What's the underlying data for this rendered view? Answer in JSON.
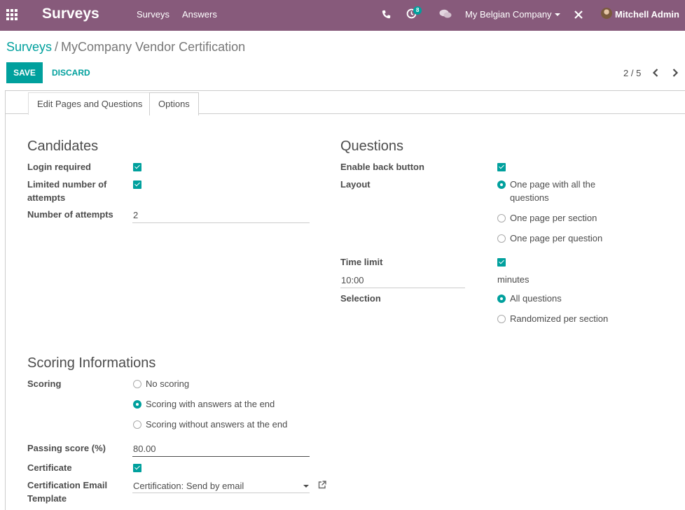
{
  "navbar": {
    "app_name": "Surveys",
    "menu": [
      "Surveys",
      "Answers"
    ],
    "activity_count": "8",
    "company": "My Belgian Company",
    "user": "Mitchell Admin",
    "icons": [
      "apps-grid-icon",
      "phone-icon",
      "clock-icon",
      "chat-icon",
      "tools-icon"
    ]
  },
  "breadcrumb": {
    "parent": "Surveys",
    "separator": "/",
    "current": "MyCompany Vendor Certification"
  },
  "toolbar": {
    "save_label": "SAVE",
    "discard_label": "DISCARD",
    "pager": "2 / 5"
  },
  "tabs": [
    {
      "label": "Edit Pages and Questions",
      "active": false
    },
    {
      "label": "Options",
      "active": true
    }
  ],
  "candidates": {
    "title": "Candidates",
    "login_required_label": "Login required",
    "login_required": true,
    "limited_attempts_label_1": "Limited number of",
    "limited_attempts_label_2": "attempts",
    "limited_attempts": true,
    "num_attempts_label": "Number of attempts",
    "num_attempts": "2"
  },
  "questions": {
    "title": "Questions",
    "back_button_label": "Enable back button",
    "back_button": true,
    "layout_label": "Layout",
    "layout_options": [
      "One page with all the",
      "questions",
      "One page per section",
      "One page per question"
    ],
    "layout_selected": "One page with all the questions",
    "time_limit_label": "Time limit",
    "time_limit_enabled": true,
    "time_limit_value": "10:00",
    "time_unit": "minutes",
    "selection_label": "Selection",
    "selection_options": [
      "All questions",
      "Randomized per section"
    ],
    "selection_selected": "All questions"
  },
  "scoring": {
    "title": "Scoring Informations",
    "scoring_label": "Scoring",
    "scoring_options": [
      "No scoring",
      "Scoring with answers at the end",
      "Scoring without answers at the end"
    ],
    "scoring_selected": "Scoring with answers at the end",
    "passing_label": "Passing score (%)",
    "passing_value": "80.00",
    "certificate_label": "Certificate",
    "certificate": true,
    "email_template_label_1": "Certification Email",
    "email_template_label_2": "Template",
    "email_template_value": "Certification: Send by email"
  },
  "colors": {
    "navbar": "#875a7b",
    "accent": "#00a09d",
    "text": "#4c4c4c"
  }
}
